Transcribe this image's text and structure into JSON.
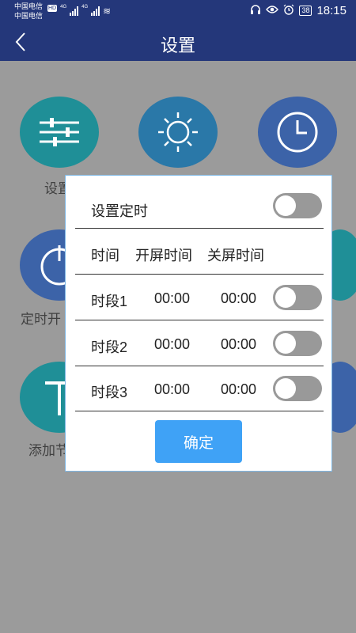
{
  "status_bar": {
    "carrier1": "中国电信",
    "carrier2": "中国电信",
    "hd_badge": "HD",
    "net1": "4G",
    "net2": "4G",
    "battery": "38",
    "time": "18:15"
  },
  "header": {
    "title": "设置",
    "back_icon": "chevron-left-icon"
  },
  "background": {
    "labels": [
      "设置",
      "定时开",
      "添加节"
    ]
  },
  "dialog": {
    "set_timer_label": "设置定时",
    "set_timer_on": false,
    "col_time": "时间",
    "col_on": "开屏时间",
    "col_off": "关屏时间",
    "periods": [
      {
        "label": "时段1",
        "on_time": "00:00",
        "off_time": "00:00",
        "enabled": false
      },
      {
        "label": "时段2",
        "on_time": "00:00",
        "off_time": "00:00",
        "enabled": false
      },
      {
        "label": "时段3",
        "on_time": "00:00",
        "off_time": "00:00",
        "enabled": false
      }
    ],
    "confirm_label": "确定"
  },
  "colors": {
    "header": "#24377a",
    "dim_background": "#9b9b9b",
    "confirm_button": "#3fa2f6",
    "toggle_off": "#999999"
  }
}
